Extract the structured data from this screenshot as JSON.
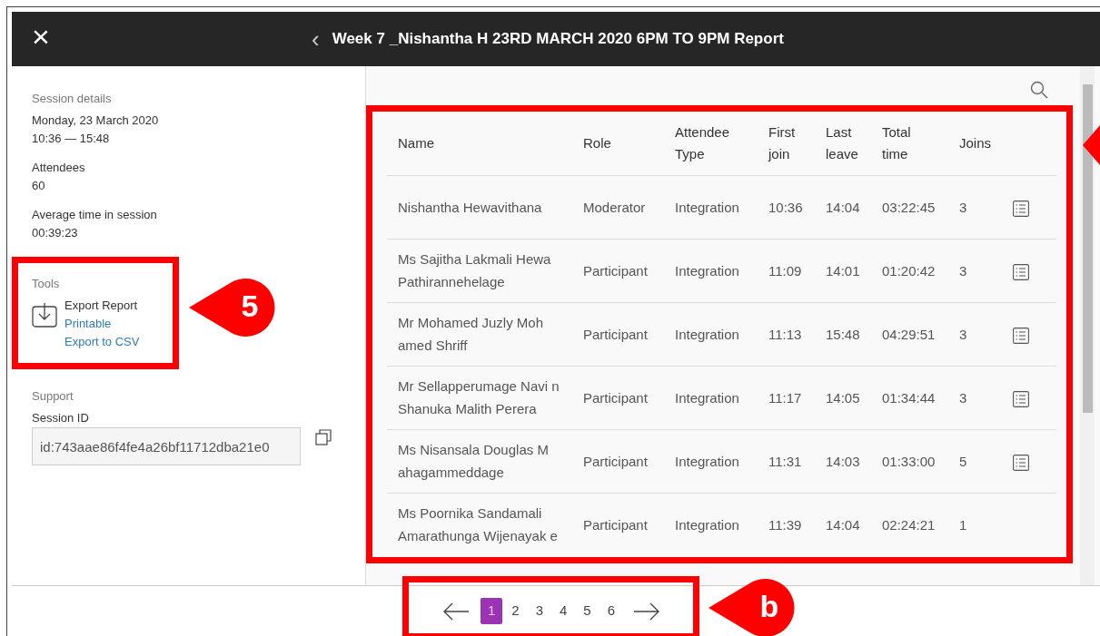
{
  "header": {
    "close": "×",
    "back": "‹",
    "title": "Week 7 _Nishantha H 23RD MARCH 2020 6PM TO 9PM Report"
  },
  "sidebar": {
    "session_details": {
      "heading": "Session details",
      "date": "Monday, 23 March 2020",
      "time": "10:36 — 15:48"
    },
    "stats": [
      {
        "label": "Attendees",
        "value": "60"
      },
      {
        "label": "Average time in session",
        "value": "00:39:23"
      }
    ],
    "tools": {
      "heading": "Tools",
      "title": "Export Report",
      "links": [
        "Printable",
        "Export to CSV"
      ]
    },
    "support": {
      "heading": "Support",
      "label": "Session ID",
      "value": "id:743aae86f4fe4a26bf11712dba21e0"
    }
  },
  "table": {
    "columns": [
      "Name",
      "Role",
      "Attendee Type",
      "First join",
      "Last leave",
      "Total time",
      "Joins"
    ],
    "rows": [
      [
        "Nishantha Hewavithana",
        "Moderator",
        "Integration",
        "10:36",
        "14:04",
        "03:22:45",
        "3"
      ],
      [
        "Ms Sajitha Lakmali Hewa Pathirannehelage",
        "Participant",
        "Integration",
        "11:09",
        "14:01",
        "01:20:42",
        "3"
      ],
      [
        "Mr Mohamed Juzly Moh amed Shriff",
        "Participant",
        "Integration",
        "11:13",
        "15:48",
        "04:29:51",
        "3"
      ],
      [
        "Mr Sellapperumage Navi n Shanuka Malith Perera",
        "Participant",
        "Integration",
        "11:17",
        "14:05",
        "01:34:44",
        "3"
      ],
      [
        "Ms Nisansala Douglas M ahagammeddage",
        "Participant",
        "Integration",
        "11:31",
        "14:03",
        "01:33:00",
        "5"
      ],
      [
        "Ms Poornika Sandamali Amarathunga Wijenayak e",
        "Participant",
        "Integration",
        "11:39",
        "14:04",
        "02:24:21",
        "1"
      ]
    ]
  },
  "pagination": {
    "pages": [
      {
        "label": "1",
        "selected": true
      },
      {
        "label": "2",
        "selected": false
      },
      {
        "label": "3",
        "selected": false
      },
      {
        "label": "4",
        "selected": false
      },
      {
        "label": "5",
        "selected": false
      },
      {
        "label": "6",
        "selected": false
      }
    ]
  },
  "annotations": [
    {
      "kind": "callout",
      "label": "5"
    },
    {
      "kind": "callout",
      "label": "b"
    },
    {
      "kind": "edge-callout"
    }
  ]
}
